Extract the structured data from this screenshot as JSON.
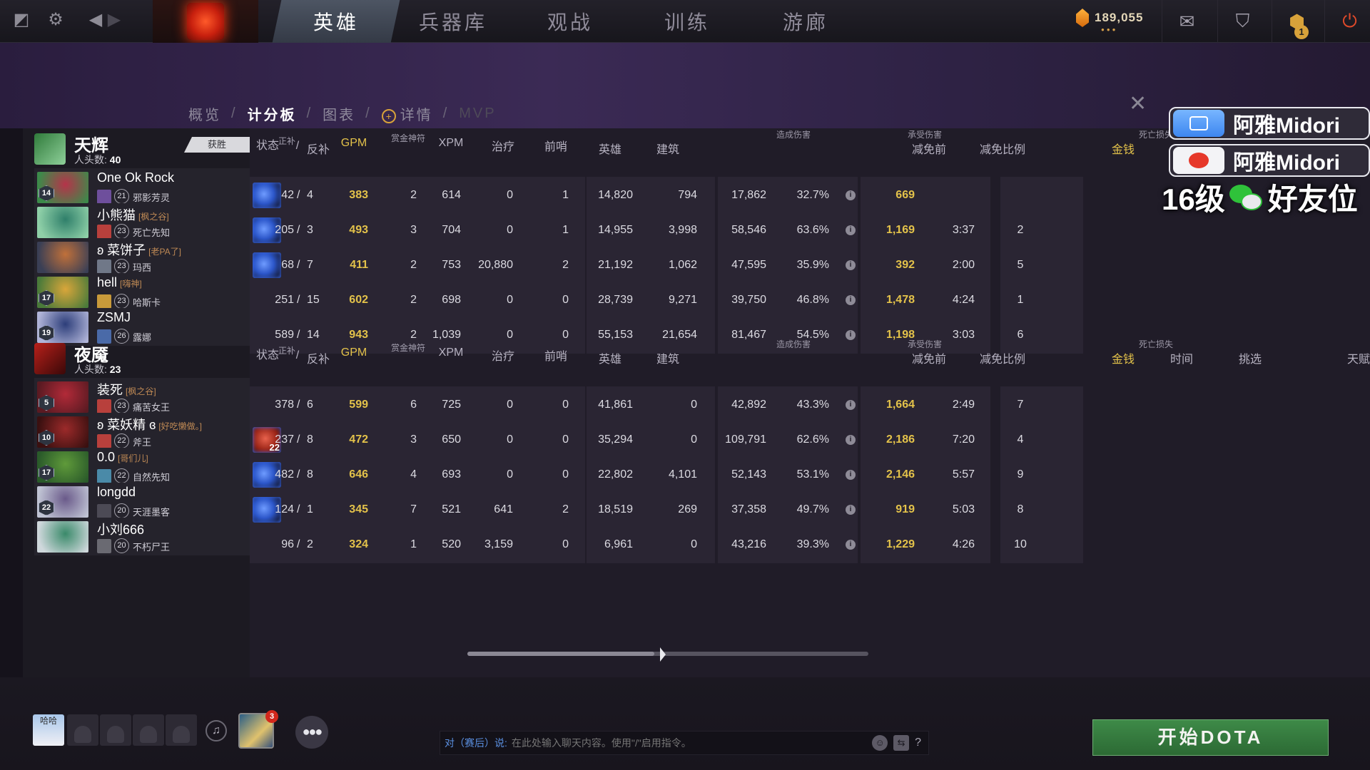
{
  "topnav": {
    "tabs": [
      "英雄",
      "兵器库",
      "观战",
      "训练",
      "游廊"
    ],
    "active_tab": "英雄",
    "currency": "189,055",
    "notification_count": "1"
  },
  "subnav": {
    "items": [
      "概览",
      "计分板",
      "图表",
      "详情",
      "MVP"
    ],
    "separator": "/"
  },
  "columns": {
    "status": "状态",
    "lasthits": "正补",
    "slash": "/",
    "denies": "反补",
    "gpm": "GPM",
    "bounty_runes": "赏金神符",
    "xpm": "XPM",
    "heal": "治疗",
    "wards": "前哨",
    "dmg_dealt_group": "造成伤害",
    "hero": "英雄",
    "building": "建筑",
    "dmg_taken_group": "承受伤害",
    "before_reduce": "减免前",
    "reduce_pct": "减免比例",
    "death_loss_group": "死亡损失",
    "gold": "金钱",
    "time": "时间",
    "pick": "挑选",
    "next": "天赋"
  },
  "radiant": {
    "name": "天辉",
    "kills_label": "人头数:",
    "kills": "40",
    "result": "获胜",
    "players": [
      {
        "name": "One Ok Rock",
        "guild": "",
        "prefix": "",
        "level": "21",
        "hero_level": "14",
        "hero": "邪影芳灵",
        "lh": "42",
        "dn": "4",
        "gpm": "383",
        "runes": "2",
        "xpm": "614",
        "heal": "0",
        "wards": "1",
        "hero_dmg": "14,820",
        "bld_dmg": "794",
        "taken": "17,862",
        "reduce": "32.7%",
        "gold_lost": "669",
        "time": "",
        "pick": "",
        "status": "blue"
      },
      {
        "name": "小熊猫",
        "guild": "[枫之谷]",
        "prefix": "",
        "level": "23",
        "hero_level": "",
        "hero": "死亡先知",
        "lh": "205",
        "dn": "3",
        "gpm": "493",
        "runes": "3",
        "xpm": "704",
        "heal": "0",
        "wards": "1",
        "hero_dmg": "14,955",
        "bld_dmg": "3,998",
        "taken": "58,546",
        "reduce": "63.6%",
        "gold_lost": "1,169",
        "time": "3:37",
        "pick": "2",
        "status": "blue"
      },
      {
        "name": "菜饼子",
        "guild": "[老PA了]",
        "prefix": "ʚ",
        "level": "23",
        "hero_level": "",
        "hero": "玛西",
        "lh": "68",
        "dn": "7",
        "gpm": "411",
        "runes": "2",
        "xpm": "753",
        "heal": "20,880",
        "wards": "2",
        "hero_dmg": "21,192",
        "bld_dmg": "1,062",
        "taken": "47,595",
        "reduce": "35.9%",
        "gold_lost": "392",
        "time": "2:00",
        "pick": "5",
        "status": "blue"
      },
      {
        "name": "hell",
        "guild": "[嗨神]",
        "prefix": "",
        "level": "23",
        "hero_level": "17",
        "hero": "哈斯卡",
        "lh": "251",
        "dn": "15",
        "gpm": "602",
        "runes": "2",
        "xpm": "698",
        "heal": "0",
        "wards": "0",
        "hero_dmg": "28,739",
        "bld_dmg": "9,271",
        "taken": "39,750",
        "reduce": "46.8%",
        "gold_lost": "1,478",
        "time": "4:24",
        "pick": "1",
        "status": ""
      },
      {
        "name": "ZSMJ",
        "guild": "",
        "prefix": "",
        "level": "26",
        "hero_level": "19",
        "hero": "露娜",
        "lh": "589",
        "dn": "14",
        "gpm": "943",
        "runes": "2",
        "xpm": "1,039",
        "heal": "0",
        "wards": "0",
        "hero_dmg": "55,153",
        "bld_dmg": "21,654",
        "taken": "81,467",
        "reduce": "54.5%",
        "gold_lost": "1,198",
        "time": "3:03",
        "pick": "6",
        "status": ""
      }
    ]
  },
  "dire": {
    "name": "夜魇",
    "kills_label": "人头数:",
    "kills": "23",
    "players": [
      {
        "name": "装死",
        "guild": "[枫之谷]",
        "prefix": "",
        "level": "23",
        "hero_level": "5",
        "hero": "痛苦女王",
        "lh": "378",
        "dn": "6",
        "gpm": "599",
        "runes": "6",
        "xpm": "725",
        "heal": "0",
        "wards": "0",
        "hero_dmg": "41,861",
        "bld_dmg": "0",
        "taken": "42,892",
        "reduce": "43.3%",
        "gold_lost": "1,664",
        "time": "2:49",
        "pick": "7",
        "status": ""
      },
      {
        "name": "菜妖精",
        "guild": "[好吃懒做。]",
        "prefix": "ʚ",
        "suffix": "ɞ",
        "level": "22",
        "hero_level": "10",
        "hero": "斧王",
        "lh": "237",
        "dn": "8",
        "gpm": "472",
        "runes": "3",
        "xpm": "650",
        "heal": "0",
        "wards": "0",
        "hero_dmg": "35,294",
        "bld_dmg": "0",
        "taken": "109,791",
        "reduce": "62.6%",
        "gold_lost": "2,186",
        "time": "7:20",
        "pick": "4",
        "status": "red",
        "status_num": "22"
      },
      {
        "name": "0.0",
        "guild": "[哥们儿]",
        "prefix": "",
        "level": "22",
        "hero_level": "17",
        "hero": "自然先知",
        "lh": "482",
        "dn": "8",
        "gpm": "646",
        "runes": "4",
        "xpm": "693",
        "heal": "0",
        "wards": "0",
        "hero_dmg": "22,802",
        "bld_dmg": "4,101",
        "taken": "52,143",
        "reduce": "53.1%",
        "gold_lost": "2,146",
        "time": "5:57",
        "pick": "9",
        "status": "blue"
      },
      {
        "name": "longdd",
        "guild": "",
        "prefix": "",
        "level": "20",
        "hero_level": "22",
        "hero": "天涯墨客",
        "lh": "124",
        "dn": "1",
        "gpm": "345",
        "runes": "7",
        "xpm": "521",
        "heal": "641",
        "wards": "2",
        "hero_dmg": "18,519",
        "bld_dmg": "269",
        "taken": "37,358",
        "reduce": "49.7%",
        "gold_lost": "919",
        "time": "5:03",
        "pick": "8",
        "status": "blue"
      },
      {
        "name": "小刘666",
        "guild": "",
        "prefix": "",
        "level": "20",
        "hero_level": "",
        "hero": "不朽尸王",
        "lh": "96",
        "dn": "2",
        "gpm": "324",
        "runes": "1",
        "xpm": "520",
        "heal": "3,159",
        "wards": "0",
        "hero_dmg": "6,961",
        "bld_dmg": "0",
        "taken": "43,216",
        "reduce": "39.3%",
        "gold_lost": "1,229",
        "time": "4:26",
        "pick": "10",
        "status": ""
      }
    ]
  },
  "overlay": {
    "line1": "阿雅Midori",
    "line2": "阿雅Midori",
    "line3_a": "16级",
    "line3_b": "好友位"
  },
  "bottom": {
    "avatar_text": "哈哈",
    "item_badge": "3",
    "chat_prefix": "对（赛后）说:",
    "chat_placeholder": "在此处输入聊天内容。使用\"/\"启用指令。",
    "help": "?",
    "start_button": "开始DOTA"
  },
  "colors": {
    "accent_gold": "#e3c24a",
    "start_green": "#2f7a3a",
    "active_tab": "#4d5563"
  }
}
